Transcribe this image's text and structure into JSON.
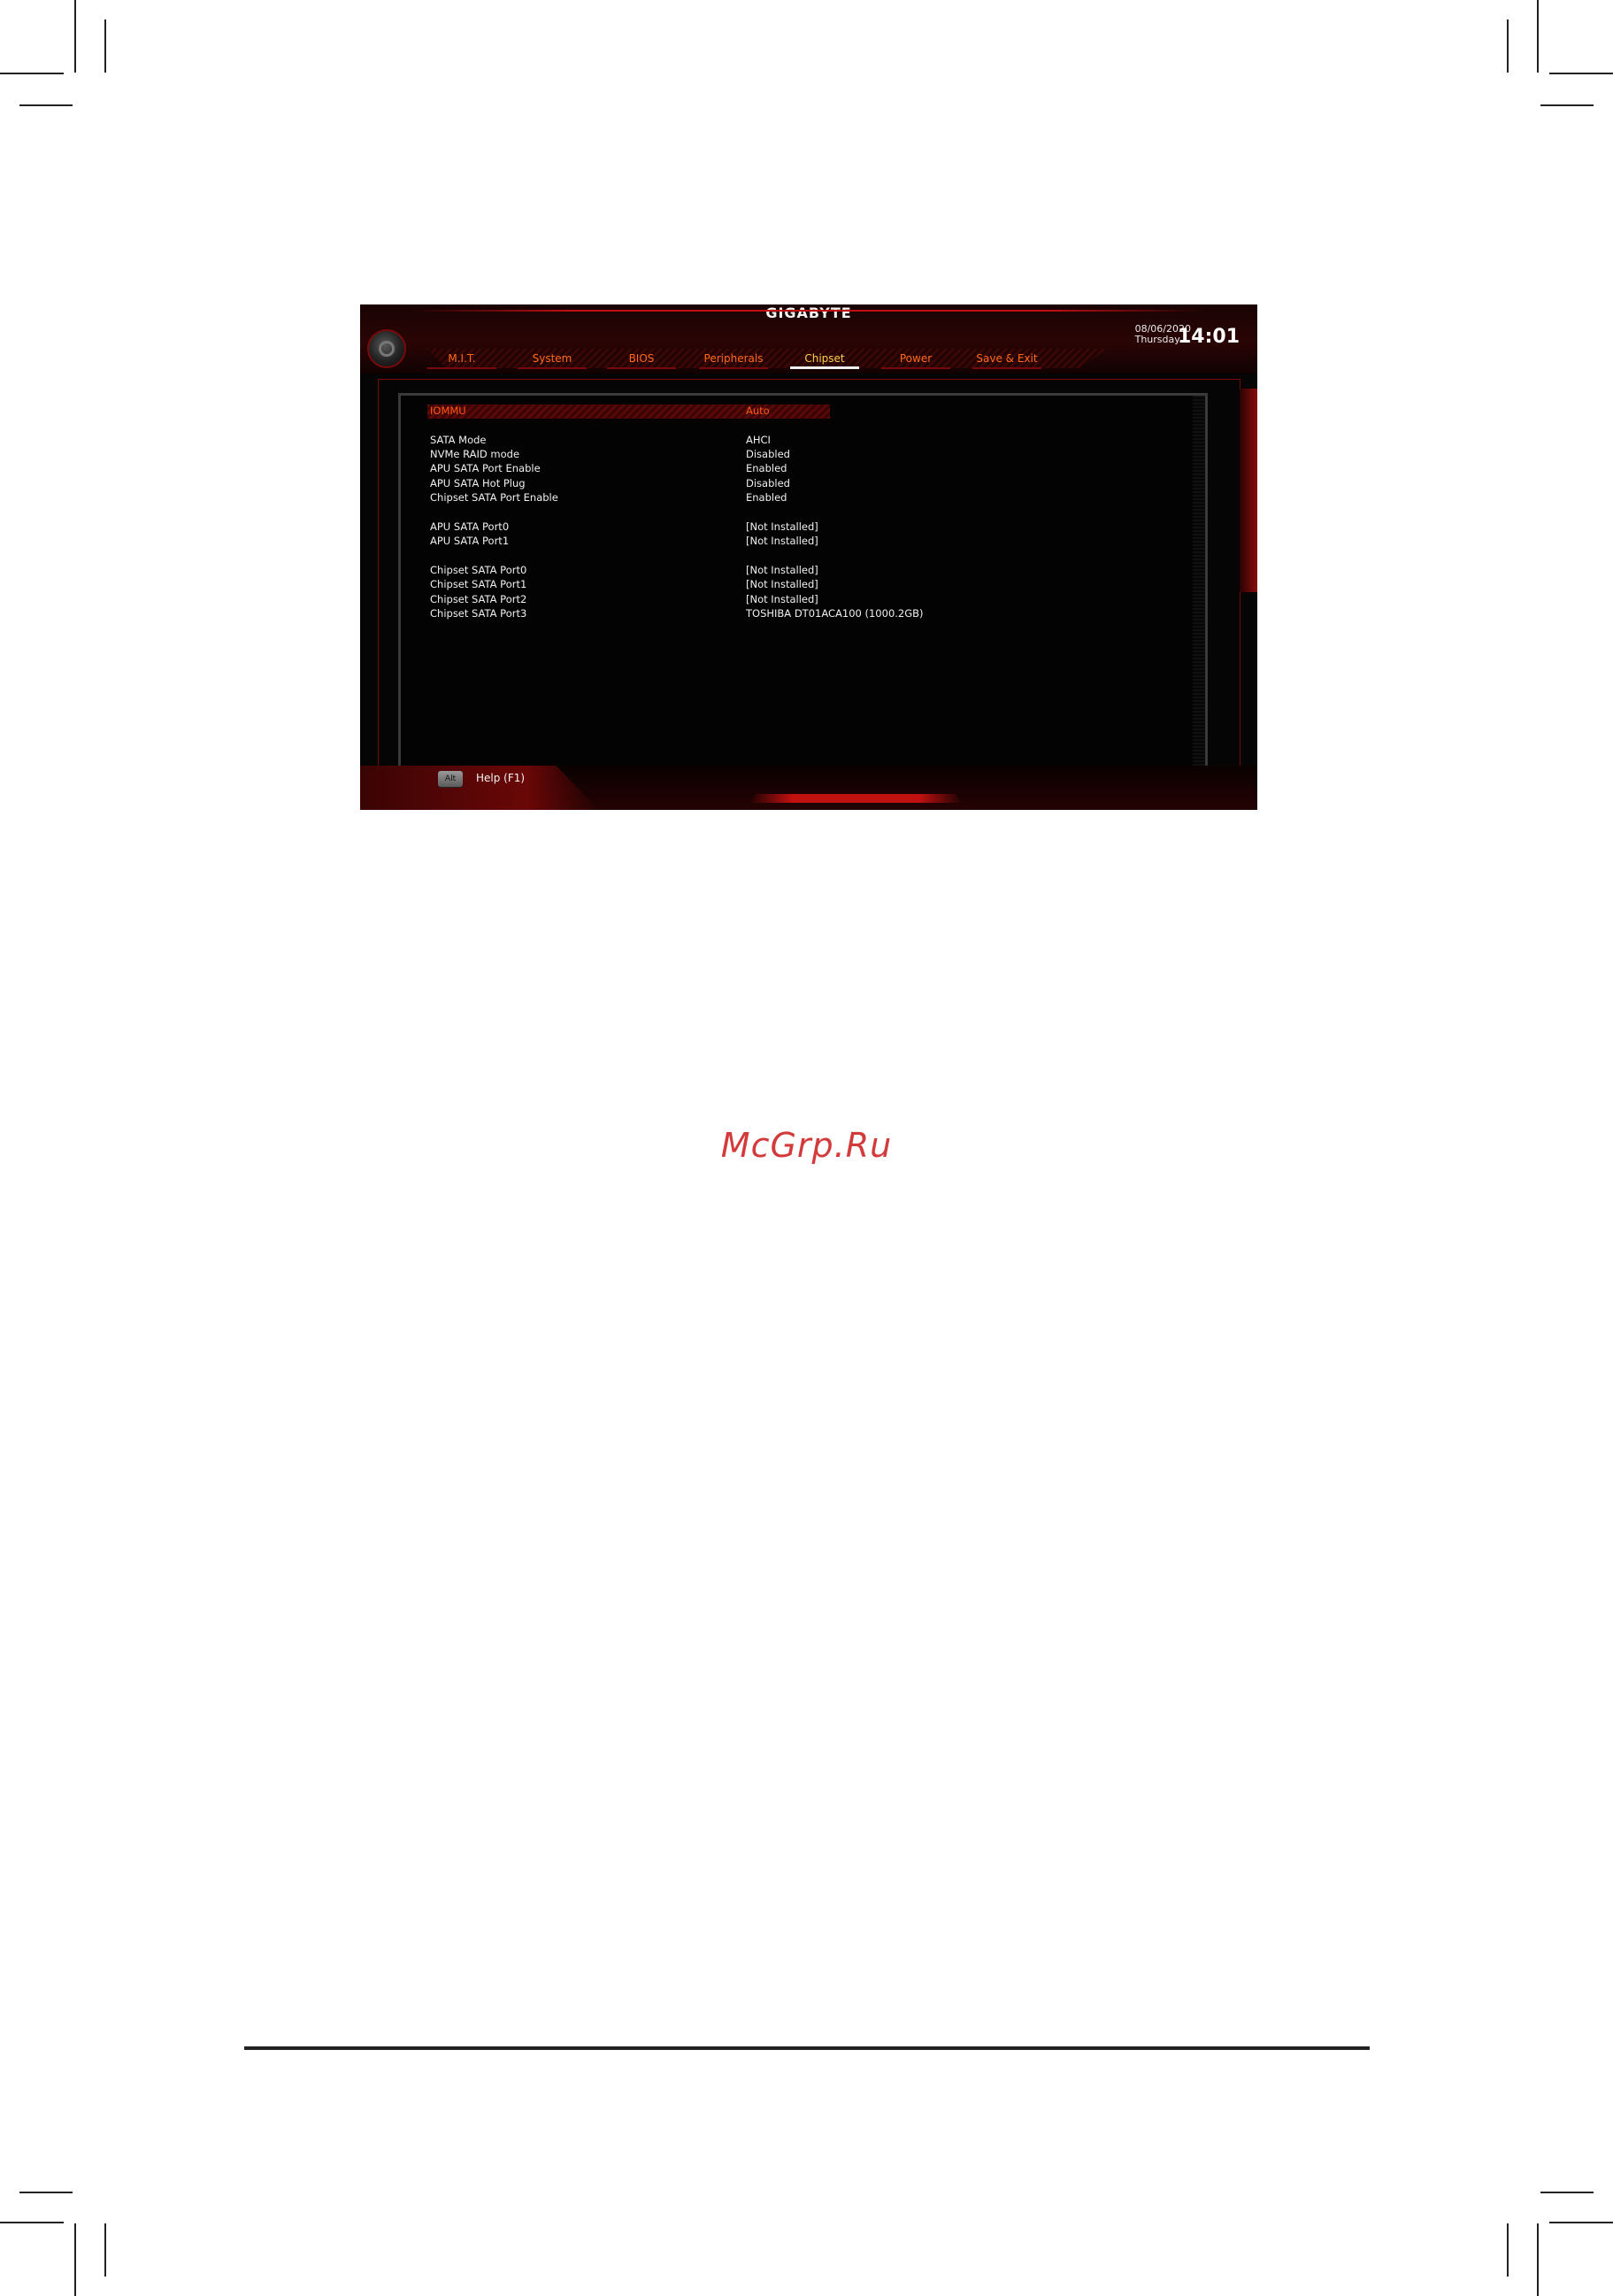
{
  "bios": {
    "brand": "GIGABYTE",
    "tabs": [
      "M.I.T.",
      "System",
      "BIOS",
      "Peripherals",
      "Chipset",
      "Power",
      "Save & Exit"
    ],
    "active_tab": "Chipset",
    "date": "08/06/2020",
    "day": "Thursday",
    "time": "14:01",
    "settings": [
      {
        "label": "IOMMU",
        "value": "Auto"
      },
      {
        "label": "SATA Mode",
        "value": "AHCI"
      },
      {
        "label": "NVMe RAID mode",
        "value": "Disabled"
      },
      {
        "label": "APU SATA Port Enable",
        "value": "Enabled"
      },
      {
        "label": "APU SATA Hot Plug",
        "value": "Disabled"
      },
      {
        "label": "Chipset SATA Port Enable",
        "value": "Enabled"
      },
      {
        "label": "APU SATA Port0",
        "value": "[Not Installed]"
      },
      {
        "label": "APU SATA Port1",
        "value": "[Not Installed]"
      },
      {
        "label": "Chipset SATA Port0",
        "value": "[Not Installed]"
      },
      {
        "label": "Chipset SATA Port1",
        "value": "[Not Installed]"
      },
      {
        "label": "Chipset SATA Port2",
        "value": "[Not Installed]"
      },
      {
        "label": "Chipset SATA Port3",
        "value": "TOSHIBA DT01ACA100 (1000.2GB)"
      }
    ],
    "help": {
      "key": "Alt",
      "label": "Help (F1)"
    }
  },
  "watermark": "McGrp.Ru"
}
